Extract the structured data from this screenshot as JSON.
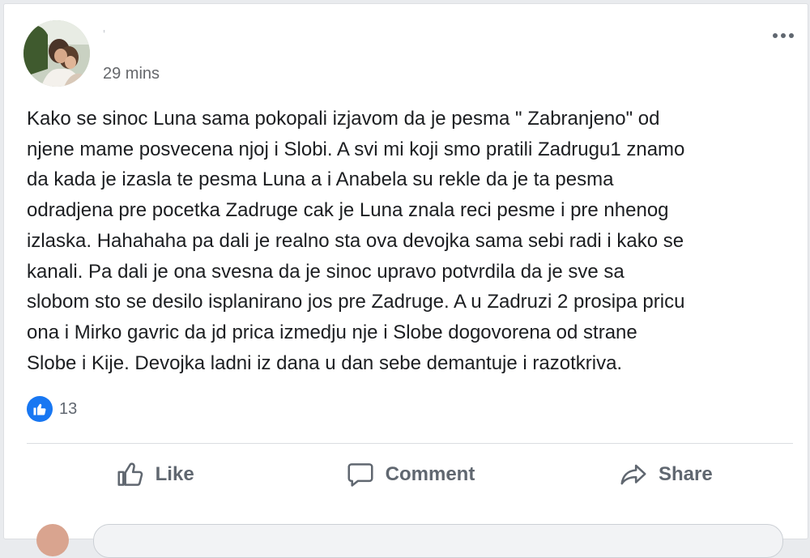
{
  "post": {
    "author_name": "'",
    "timestamp": "29 mins",
    "text_lines": [
      "Kako se sinoc Luna sama pokopali izjavom da je pesma \" Zabranjeno\" od",
      "njene mame posvecena njoj i Slobi. A svi mi koji smo pratili Zadrugu1 znamo",
      "da kada je izasla te pesma Luna a i Anabela su rekle da je ta pesma",
      "odradjena pre pocetka Zadruge cak je Luna znala reci pesme i pre nhenog",
      "izlaska. Hahahaha pa dali je realno sta ova devojka sama sebi radi i kako se",
      "kanali. Pa dali je ona svesna da je sinoc upravo potvrdila da je sve sa",
      "slobom sto se desilo isplanirano jos pre Zadruge. A u Zadruzi 2 prosipa pricu",
      "ona i Mirko gavric da jd prica izmedju nje i Slobe dogovorena od strane",
      "Slobe i Kije. Devojka ladni iz dana u dan sebe demantuje i razotkriva."
    ],
    "reactions": {
      "icon": "like-icon",
      "count": "13",
      "color": "#1877f2"
    }
  },
  "actions": {
    "like_label": "Like",
    "comment_label": "Comment",
    "share_label": "Share"
  },
  "icons": {
    "menu": "more-horizontal-icon",
    "like": "thumbs-up-icon",
    "comment": "speech-bubble-icon",
    "share": "share-arrow-icon"
  }
}
